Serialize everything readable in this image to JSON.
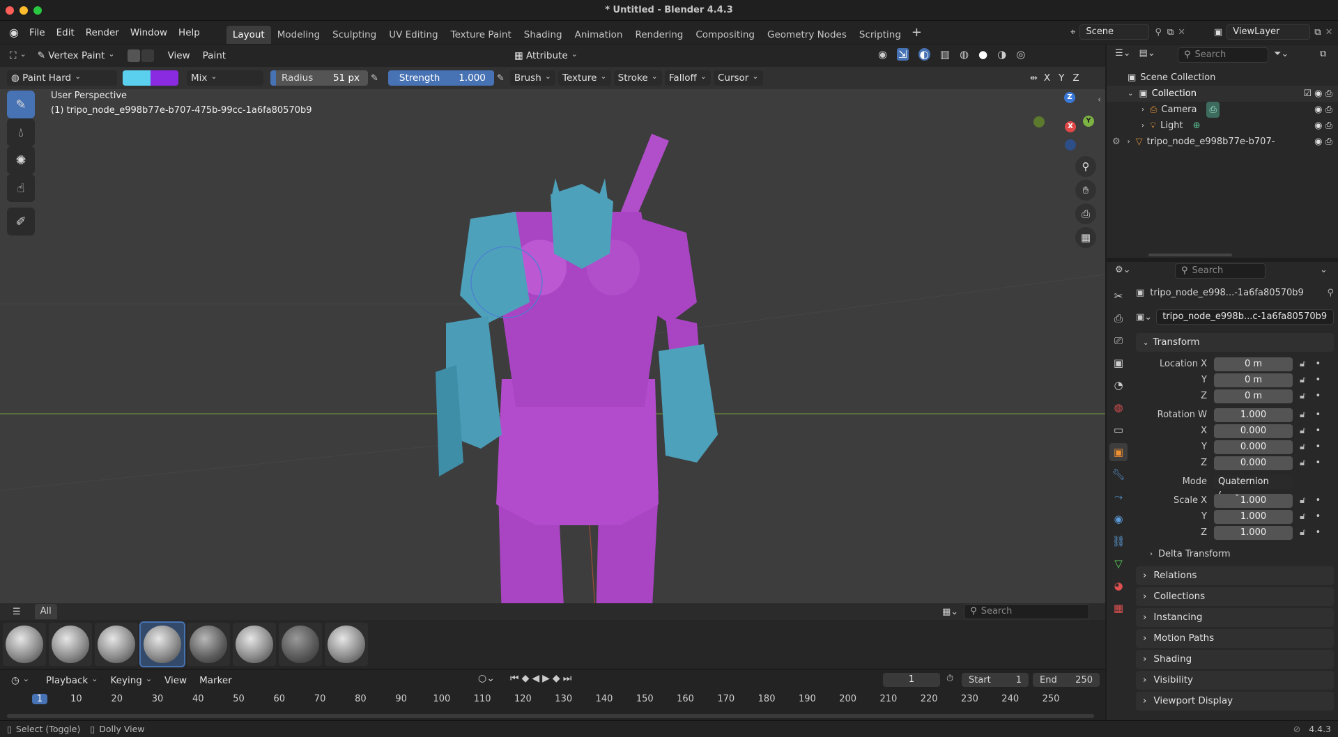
{
  "window": {
    "title": "* Untitled - Blender 4.4.3"
  },
  "menu": [
    "File",
    "Edit",
    "Render",
    "Window",
    "Help"
  ],
  "workspaces": [
    "Layout",
    "Modeling",
    "Sculpting",
    "UV Editing",
    "Texture Paint",
    "Shading",
    "Animation",
    "Rendering",
    "Compositing",
    "Geometry Nodes",
    "Scripting"
  ],
  "active_workspace": "Layout",
  "scene": {
    "name": "Scene",
    "view_layer": "ViewLayer"
  },
  "viewport": {
    "mode": "Vertex Paint",
    "menus": [
      "View",
      "Paint"
    ],
    "attribute": "Attribute",
    "overlay_line1": "User Perspective",
    "overlay_line2": "(1) tripo_node_e998b77e-b707-475b-99cc-1a6fa80570b9",
    "axes": {
      "x": "X",
      "y": "Y",
      "z": "Z"
    }
  },
  "tool_settings": {
    "brush": "Paint Hard",
    "primary_color": "#5ad0ee",
    "secondary_color": "#8a2be2",
    "blend": "Mix",
    "radius_label": "Radius",
    "radius_value": "51 px",
    "strength_label": "Strength",
    "strength_value": "1.000",
    "strength_fraction": 1.0,
    "menus": [
      "Brush",
      "Texture",
      "Stroke",
      "Falloff",
      "Cursor"
    ],
    "mirror": [
      "X",
      "Y",
      "Z"
    ]
  },
  "asset_shelf": {
    "tab": "All",
    "search_placeholder": "Search",
    "brush_count": 8,
    "selected_index": 3
  },
  "timeline": {
    "menus": [
      "Playback",
      "Keying",
      "View",
      "Marker"
    ],
    "current_frame": "1",
    "start_label": "Start",
    "start": "1",
    "end_label": "End",
    "end": "250",
    "ticks": [
      "1",
      "10",
      "20",
      "30",
      "40",
      "50",
      "60",
      "70",
      "80",
      "90",
      "100",
      "110",
      "120",
      "130",
      "140",
      "150",
      "160",
      "170",
      "180",
      "190",
      "200",
      "210",
      "220",
      "230",
      "240",
      "250"
    ]
  },
  "outliner": {
    "search_placeholder": "Search",
    "scene_collection": "Scene Collection",
    "collection": "Collection",
    "items": [
      "Camera",
      "Light"
    ],
    "object": "tripo_node_e998b77e-b707-"
  },
  "properties": {
    "search_placeholder": "Search",
    "object_header": "tripo_node_e998...-1a6fa80570b9",
    "object_name": "tripo_node_e998b...c-1a6fa80570b9",
    "transform_title": "Transform",
    "location": [
      {
        "label": "Location X",
        "value": "0 m"
      },
      {
        "label": "Y",
        "value": "0 m"
      },
      {
        "label": "Z",
        "value": "0 m"
      }
    ],
    "rotation": [
      {
        "label": "Rotation W",
        "value": "1.000"
      },
      {
        "label": "X",
        "value": "0.000"
      },
      {
        "label": "Y",
        "value": "0.000"
      },
      {
        "label": "Z",
        "value": "0.000"
      }
    ],
    "mode_label": "Mode",
    "mode_value": "Quaternion (...",
    "scale": [
      {
        "label": "Scale X",
        "value": "1.000"
      },
      {
        "label": "Y",
        "value": "1.000"
      },
      {
        "label": "Z",
        "value": "1.000"
      }
    ],
    "delta_transform": "Delta Transform",
    "panels": [
      "Relations",
      "Collections",
      "Instancing",
      "Motion Paths",
      "Shading",
      "Visibility",
      "Viewport Display"
    ]
  },
  "status": {
    "left1": "Select (Toggle)",
    "left2": "Dolly View",
    "version": "4.4.3"
  }
}
